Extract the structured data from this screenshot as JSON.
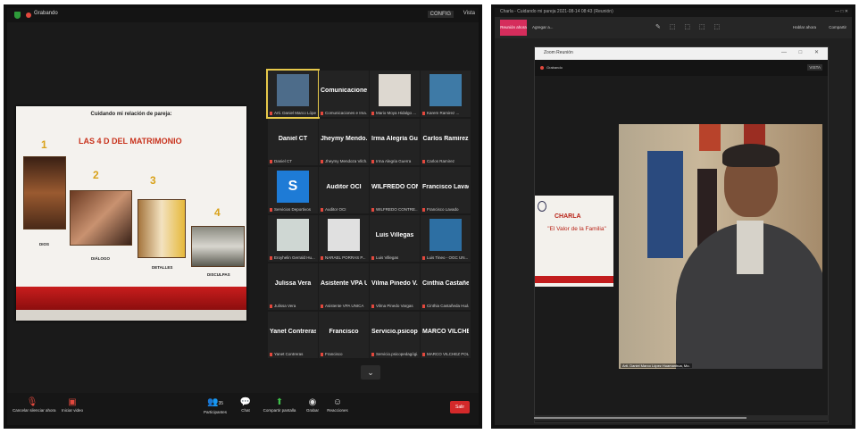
{
  "left_window": {
    "top_bar": {
      "recording": "Grabando",
      "btn_config": "CONFIG",
      "btn_view": "Vista"
    },
    "slide": {
      "title": "Cuidando mi relación de pareja:",
      "headline": "LAS 4 D DEL MATRIMONIO",
      "items": [
        {
          "num": "1",
          "caption": "DIOS"
        },
        {
          "num": "2",
          "caption": "DIÁLOGO"
        },
        {
          "num": "3",
          "caption": "DETALLES"
        },
        {
          "num": "4",
          "caption": "DISCULPAS"
        }
      ]
    },
    "tiles": [
      {
        "name": "",
        "sub": "Arti. Daniel Marco Lópe...",
        "video": "#4d6c8a",
        "active": true
      },
      {
        "name": "Comunicaciones...",
        "sub": "Comunicaciones e Ima..."
      },
      {
        "name": "",
        "sub": "Mario Moya Hidalgo ...",
        "video": "#ddd8d0"
      },
      {
        "name": "",
        "sub": "Karem Ramirez ...",
        "video": "#3e7aa6"
      },
      {
        "name": "Daniel CT",
        "sub": "Daniel CT"
      },
      {
        "name": "Jheymy Mendo...",
        "sub": "Jheymy Mendoza Vilch..."
      },
      {
        "name": "Irma Alegría Gu...",
        "sub": "Irma Alegria Guerra"
      },
      {
        "name": "Carlos Ramirez",
        "sub": "Carlos Ramirez"
      },
      {
        "name": "",
        "sub": "Servicios Deportivos",
        "video": "#1e7bd6",
        "glyph": "S"
      },
      {
        "name": "Auditor OCI",
        "sub": "Auditor OCI"
      },
      {
        "name": "WILFREDO CON...",
        "sub": "WILFREDO CONTRE..."
      },
      {
        "name": "Francisco Lavado",
        "sub": "Francisco Lavado"
      },
      {
        "name": "",
        "sub": "Eroyhelin Gerrald Hu...",
        "video": "#cfd7d3"
      },
      {
        "name": "",
        "sub": "NARAEL PORRAS P...",
        "video": "#e0e0e0"
      },
      {
        "name": "Luis Villegas",
        "sub": "Luis Villegas"
      },
      {
        "name": "",
        "sub": "Luis Tineo - OGC UN...",
        "video": "#2d6fa3"
      },
      {
        "name": "Julissa Vera",
        "sub": "Julissa Vera"
      },
      {
        "name": "Asistente VPA U...",
        "sub": "Asistente VPA UNICA"
      },
      {
        "name": "Vilma Pinedo V...",
        "sub": "Vilma Pinedo Vargas"
      },
      {
        "name": "Cinthia Castañe...",
        "sub": "Cinthia Castañeda Huá..."
      },
      {
        "name": "Yanet Contreras",
        "sub": "Yanet Contreras"
      },
      {
        "name": "Francisco",
        "sub": "Francisco"
      },
      {
        "name": "Servicio.psicope...",
        "sub": "Servicio.psicopedagógi..."
      },
      {
        "name": "MARCO VILCHE...",
        "sub": "MARCO VILCHEZ POLO"
      }
    ],
    "toolbar": {
      "mute": "Cancelar silenciar ahora",
      "video": "Iniciar video",
      "participants": "Participantes",
      "participants_count": "35",
      "chat": "Chat",
      "share": "Compartir pantalla",
      "record": "Grabar",
      "reactions": "Reacciones",
      "end": "Salir"
    }
  },
  "right_window": {
    "title_bar": "Charla - Cuidando mi pareja 2021-08-14 08:43 (Reunión)",
    "tab": "Reunión ahora",
    "tab2": "Agregar a...",
    "tools": "✎ ⬚ ⬚ ⬚ ⬚",
    "right_btn1": "Hablar ahora",
    "right_btn2": "Compartir",
    "inner_title": "Zoom Reunión",
    "inner_recording": "Grabando",
    "inner_config": "VISTA",
    "charla": {
      "title": "CHARLA",
      "subtitle": "\"El Valor de la Familia\""
    },
    "name_tag": "Arti. Daniel Marco López Huamanhua, Mo.",
    "progress": 0.72
  }
}
